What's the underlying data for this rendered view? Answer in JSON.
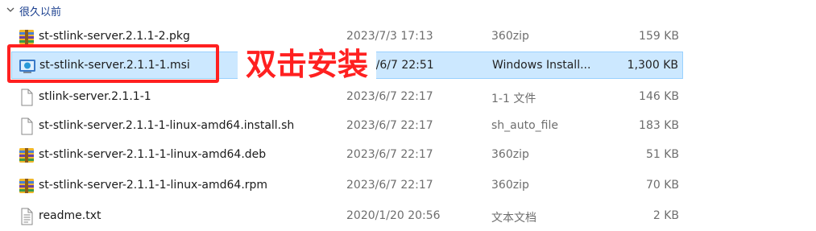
{
  "group": {
    "title": "很久以前"
  },
  "files": [
    {
      "name": "st-stlink-server.2.1.1-2.pkg",
      "date": "2023/7/3 17:13",
      "type": "360zip",
      "size": "159 KB",
      "icon": "winrar-archive-icon"
    },
    {
      "name": "st-stlink-server.2.1.1-1.msi",
      "date": "2023/6/7 22:51",
      "type": "Windows Install...",
      "size": "1,300 KB",
      "icon": "msi-installer-icon"
    },
    {
      "name": "stlink-server.2.1.1-1",
      "date": "2023/6/7 22:17",
      "type": "1-1 文件",
      "size": "146 KB",
      "icon": "blank-file-icon"
    },
    {
      "name": "st-stlink-server.2.1.1-1-linux-amd64.install.sh",
      "date": "2023/6/7 22:17",
      "type": "sh_auto_file",
      "size": "183 KB",
      "icon": "blank-file-icon"
    },
    {
      "name": "st-stlink-server-2.1.1-1-linux-amd64.deb",
      "date": "2023/6/7 22:17",
      "type": "360zip",
      "size": "51 KB",
      "icon": "winrar-archive-icon"
    },
    {
      "name": "st-stlink-server-2.1.1-1-linux-amd64.rpm",
      "date": "2023/6/7 22:17",
      "type": "360zip",
      "size": "70 KB",
      "icon": "winrar-archive-icon"
    },
    {
      "name": "readme.txt",
      "date": "2020/1/20 20:56",
      "type": "文本文档",
      "size": "2 KB",
      "icon": "text-document-icon"
    }
  ],
  "annotation": {
    "text": "双击安装",
    "color": "#ff2020"
  },
  "colors": {
    "selection": "#cce8ff",
    "selection_border": "#99d1ff",
    "highlight": "#ff2020"
  }
}
